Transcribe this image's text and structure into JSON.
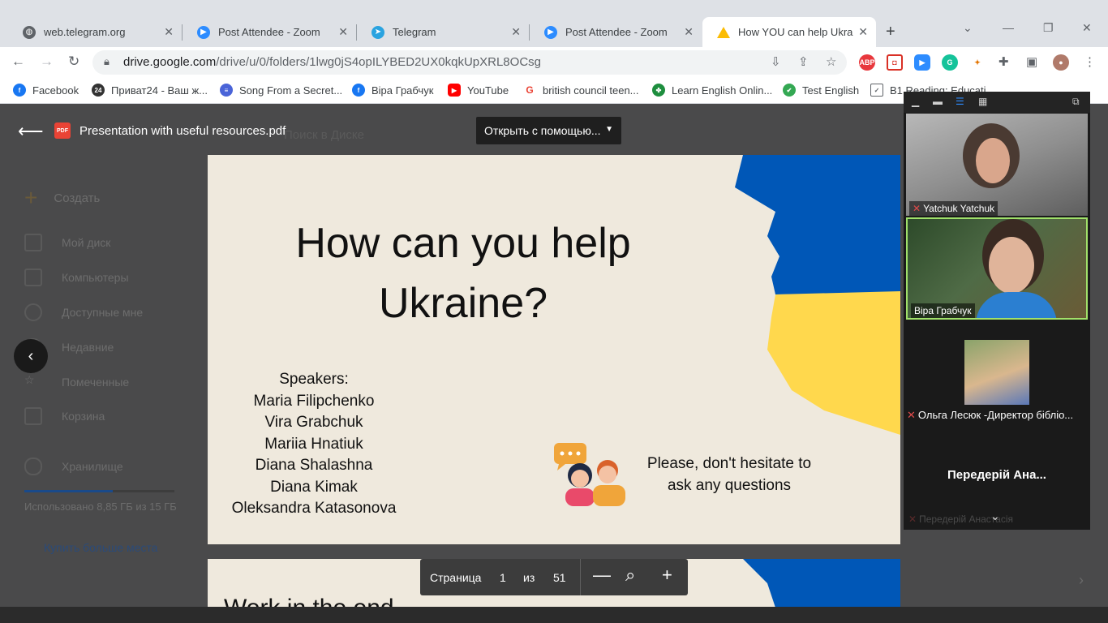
{
  "tabs": [
    {
      "label": "web.telegram.org",
      "icon": "globe-icon",
      "color": "#5f6368"
    },
    {
      "label": "Post Attendee - Zoom",
      "icon": "zoom-icon",
      "color": "#2d8cff"
    },
    {
      "label": "Telegram",
      "icon": "telegram-icon",
      "color": "#2aa3e0"
    },
    {
      "label": "Post Attendee - Zoom",
      "icon": "zoom-icon",
      "color": "#2d8cff"
    },
    {
      "label": "How YOU can help Ukrain",
      "icon": "google-drive-icon",
      "color": "#1a73e8"
    }
  ],
  "url": {
    "host": "drive.google.com",
    "path": "/drive/u/0/folders/1lwg0jS4opILYBED2UX0kqkUpXRL8OCsg"
  },
  "bookmarks": [
    {
      "label": "Facebook",
      "color": "#1877f2"
    },
    {
      "label": "Приват24 - Ваш ж...",
      "color": "#333333",
      "glyph": "24"
    },
    {
      "label": "Song From a Secret...",
      "color": "#4a64d8"
    },
    {
      "label": "Віра Грабчук",
      "color": "#1877f2"
    },
    {
      "label": "YouTube",
      "color": "#ff0000"
    },
    {
      "label": "british council teen...",
      "color": "#ea4335",
      "glyph": "G"
    },
    {
      "label": "Learn English Onlin...",
      "color": "#1e8e3e"
    },
    {
      "label": "Test English",
      "color": "#34a853"
    },
    {
      "label": "B1 Reading: Educati...",
      "color": "#5f6368"
    }
  ],
  "drive": {
    "create": "Создать",
    "items": [
      "Мой диск",
      "Компьютеры",
      "Доступные мне",
      "Недавние",
      "Помеченные",
      "Корзина"
    ],
    "storage": "Хранилище",
    "usage": "Использовано 8,85 ГБ из 15 ГБ",
    "buy": "Купить больше места",
    "search_placeholder": "Поиск в Диске",
    "storage_used_fraction": 0.59
  },
  "pdf": {
    "filename": "Presentation with useful resources.pdf",
    "open_with": "Открыть с помощью...",
    "file_type_badge": "PDF"
  },
  "slide": {
    "title": "How can you help Ukraine?",
    "speakers_heading": "Speakers:",
    "speakers": [
      "Maria Filipchenko",
      "Vira Grabchuk",
      "Mariia Hnatiuk",
      "Diana Shalashna",
      "Diana Kimak",
      "Oleksandra Katasonova"
    ],
    "prompt": "Please, don't hesitate to ask any questions",
    "flag_blue": "#0057b7",
    "flag_yellow": "#ffd84d"
  },
  "slide2": {
    "title_partial": "Work in the end"
  },
  "pager": {
    "page_label": "Страница",
    "current_page": "1",
    "of_label": "из",
    "total_pages": "51"
  },
  "zoom": {
    "participants": [
      {
        "name": "Yatchuk Yatchuk",
        "muted": true
      },
      {
        "name": "Віра Грабчук",
        "muted": false
      },
      {
        "name": "Ольга Лесюк -Директор бібліо...",
        "muted": true
      },
      {
        "name": "Передерій Ана...",
        "muted": true
      }
    ],
    "faded_name": "Передерій Анастасія"
  }
}
